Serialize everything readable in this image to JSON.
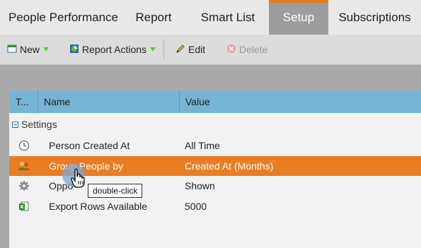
{
  "tabs": [
    {
      "label": "People Performance"
    },
    {
      "label": "Report"
    },
    {
      "label": "Smart List"
    },
    {
      "label": "Setup",
      "active": true
    },
    {
      "label": "Subscriptions"
    }
  ],
  "toolbar": {
    "new_label": "New",
    "report_actions_label": "Report Actions",
    "edit_label": "Edit",
    "delete_label": "Delete"
  },
  "grid": {
    "columns": [
      "T...",
      "Name",
      "Value"
    ],
    "group_label": "Settings",
    "rows": [
      {
        "icon": "clock-icon",
        "name": "Person Created At",
        "value": "All Time"
      },
      {
        "icon": "people-icon",
        "name": "Group People by",
        "value": "Created At (Months)",
        "selected": true
      },
      {
        "icon": "gear-icon",
        "name": "Oppo",
        "value": "Shown"
      },
      {
        "icon": "excel-icon",
        "name": "Export Rows Available",
        "value": "5000"
      }
    ]
  },
  "tooltip": {
    "text": "double-click"
  },
  "colors": {
    "accent": "#e87d23",
    "header_blue": "#76b4d4",
    "active_tab": "#9d9d9f"
  }
}
